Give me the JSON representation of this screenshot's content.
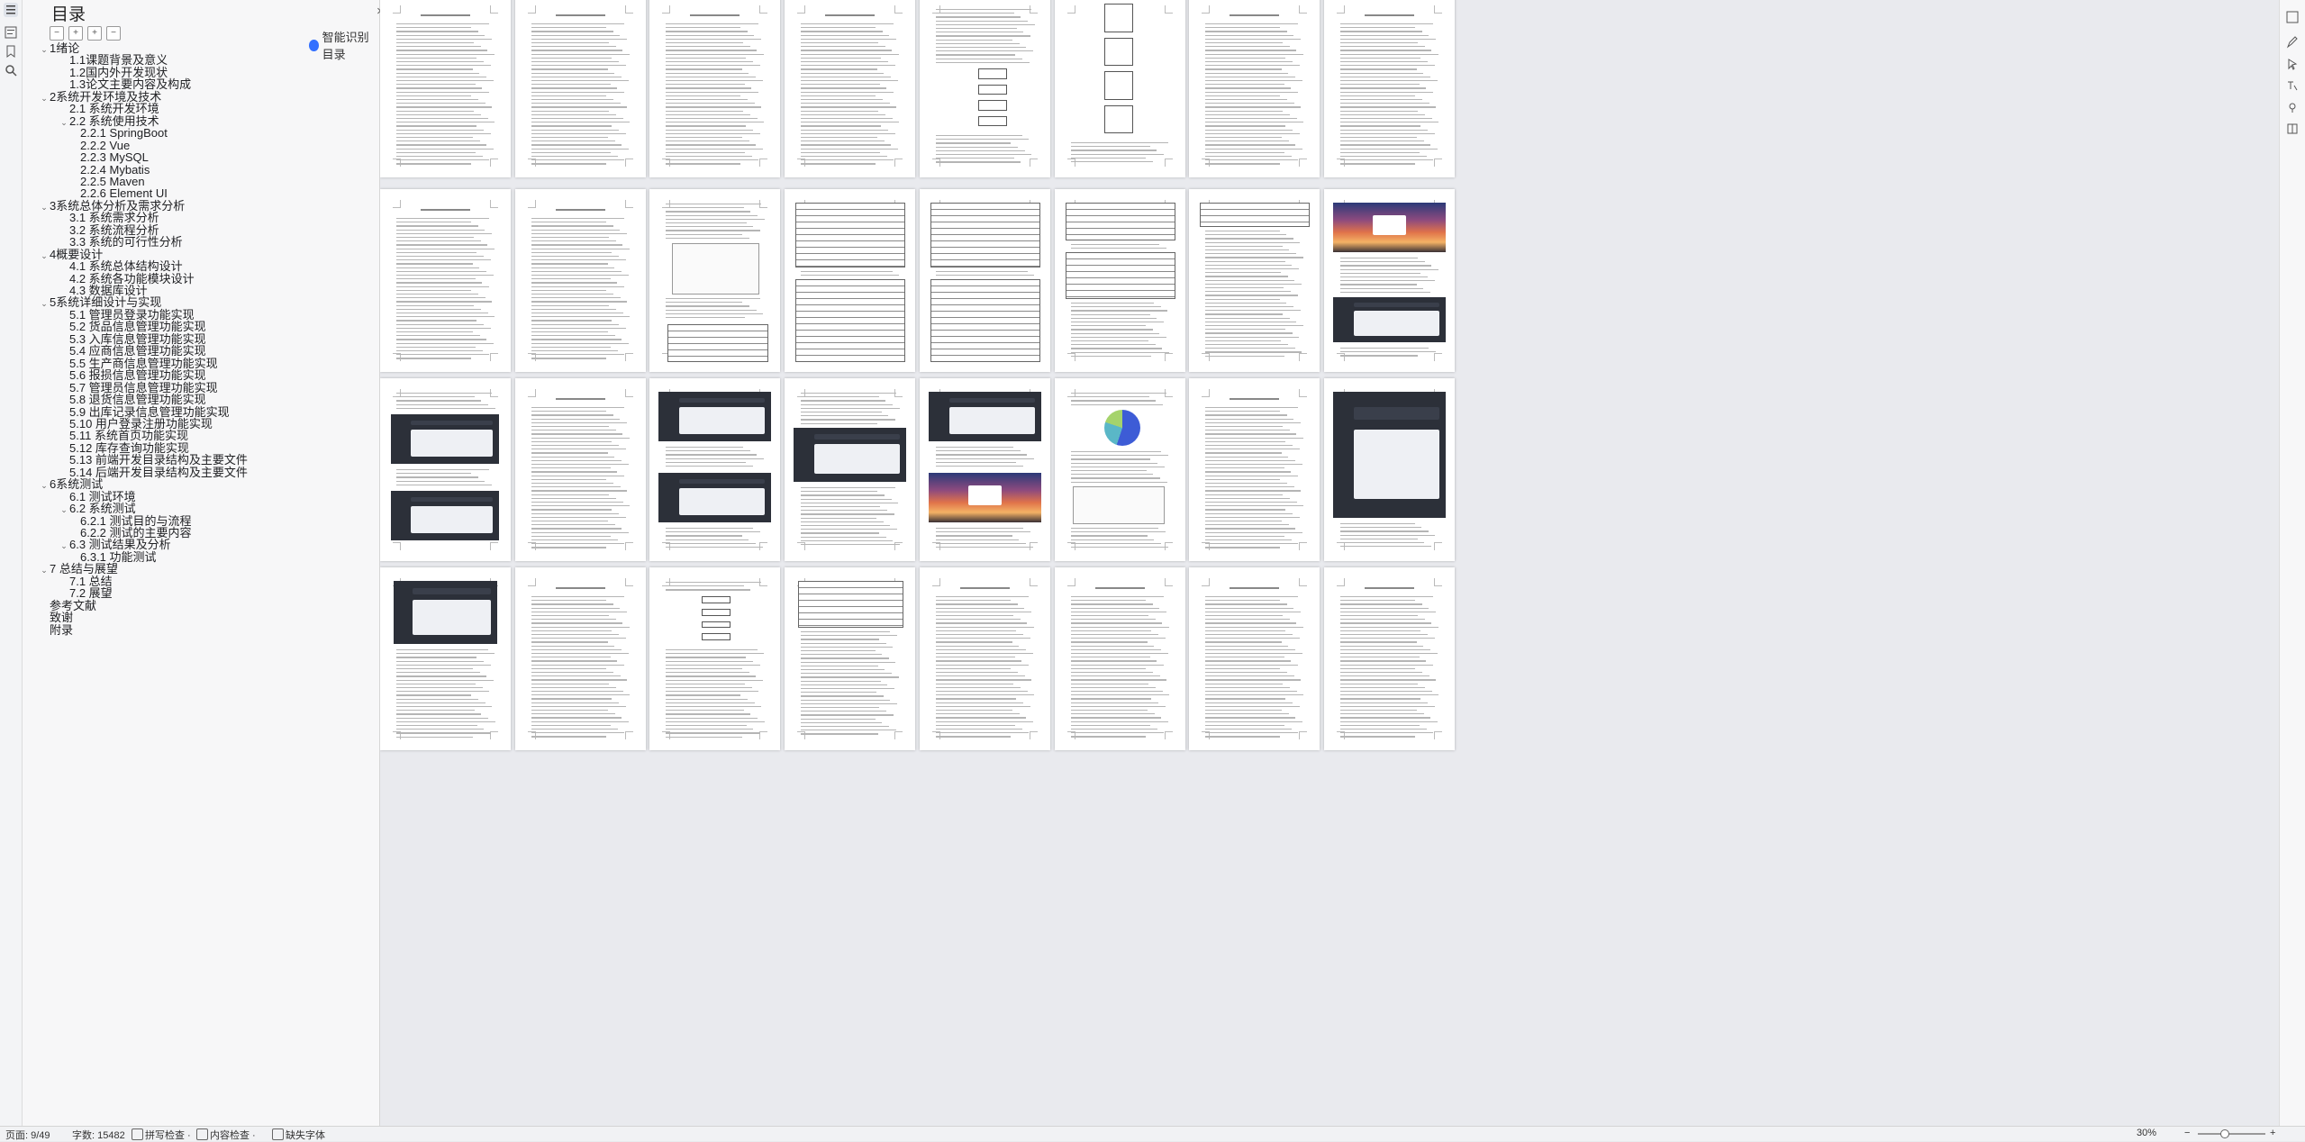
{
  "panel": {
    "title": "目录",
    "ai_label": "智能识别目录",
    "close_glyph": "×",
    "tool_glyphs": [
      "−",
      "+",
      "+",
      "−"
    ]
  },
  "toc": [
    {
      "label": "1绪论",
      "level": 0,
      "toggle": "⌄"
    },
    {
      "label": "1.1课题背景及意义",
      "level": 1,
      "toggle": ""
    },
    {
      "label": "1.2国内外开发现状",
      "level": 1,
      "toggle": ""
    },
    {
      "label": "1.3论文主要内容及构成",
      "level": 1,
      "toggle": ""
    },
    {
      "label": "2系统开发环境及技术",
      "level": 0,
      "toggle": "⌄"
    },
    {
      "label": "2.1 系统开发环境",
      "level": 1,
      "toggle": ""
    },
    {
      "label": "2.2 系统使用技术",
      "level": 1,
      "toggle": "⌄"
    },
    {
      "label": "2.2.1 SpringBoot",
      "level": 2,
      "toggle": ""
    },
    {
      "label": "2.2.2 Vue",
      "level": 2,
      "toggle": ""
    },
    {
      "label": "2.2.3 MySQL",
      "level": 2,
      "toggle": ""
    },
    {
      "label": "2.2.4 Mybatis",
      "level": 2,
      "toggle": ""
    },
    {
      "label": "2.2.5 Maven",
      "level": 2,
      "toggle": ""
    },
    {
      "label": "2.2.6 Element UI",
      "level": 2,
      "toggle": ""
    },
    {
      "label": "3系统总体分析及需求分析",
      "level": 0,
      "toggle": "⌄"
    },
    {
      "label": "3.1 系统需求分析",
      "level": 1,
      "toggle": ""
    },
    {
      "label": "3.2 系统流程分析",
      "level": 1,
      "toggle": ""
    },
    {
      "label": "3.3 系统的可行性分析",
      "level": 1,
      "toggle": ""
    },
    {
      "label": "4概要设计",
      "level": 0,
      "toggle": "⌄"
    },
    {
      "label": "4.1 系统总体结构设计",
      "level": 1,
      "toggle": ""
    },
    {
      "label": "4.2 系统各功能模块设计",
      "level": 1,
      "toggle": ""
    },
    {
      "label": "4.3 数据库设计",
      "level": 1,
      "toggle": ""
    },
    {
      "label": "5系统详细设计与实现",
      "level": 0,
      "toggle": "⌄"
    },
    {
      "label": "5.1 管理员登录功能实现",
      "level": 1,
      "toggle": ""
    },
    {
      "label": "5.2 货品信息管理功能实现",
      "level": 1,
      "toggle": ""
    },
    {
      "label": "5.3 入库信息管理功能实现",
      "level": 1,
      "toggle": ""
    },
    {
      "label": "5.4 应商信息管理功能实现",
      "level": 1,
      "toggle": ""
    },
    {
      "label": "5.5 生产商信息管理功能实现",
      "level": 1,
      "toggle": ""
    },
    {
      "label": "5.6 报损信息管理功能实现",
      "level": 1,
      "toggle": ""
    },
    {
      "label": "5.7 管理员信息管理功能实现",
      "level": 1,
      "toggle": ""
    },
    {
      "label": "5.8 退货信息管理功能实现",
      "level": 1,
      "toggle": ""
    },
    {
      "label": "5.9 出库记录信息管理功能实现",
      "level": 1,
      "toggle": ""
    },
    {
      "label": "5.10 用户登录注册功能实现",
      "level": 1,
      "toggle": ""
    },
    {
      "label": "5.11 系统首页功能实现",
      "level": 1,
      "toggle": ""
    },
    {
      "label": "5.12 库存查询功能实现",
      "level": 1,
      "toggle": ""
    },
    {
      "label": "5.13 前端开发目录结构及主要文件",
      "level": 1,
      "toggle": ""
    },
    {
      "label": "5.14 后端开发目录结构及主要文件",
      "level": 1,
      "toggle": ""
    },
    {
      "label": "6系统测试",
      "level": 0,
      "toggle": "⌄"
    },
    {
      "label": "6.1 测试环境",
      "level": 1,
      "toggle": ""
    },
    {
      "label": "6.2 系统测试",
      "level": 1,
      "toggle": "⌄"
    },
    {
      "label": "6.2.1 测试目的与流程",
      "level": 2,
      "toggle": ""
    },
    {
      "label": "6.2.2 测试的主要内容",
      "level": 2,
      "toggle": ""
    },
    {
      "label": "6.3 测试结果及分析",
      "level": 1,
      "toggle": "⌄"
    },
    {
      "label": "6.3.1 功能测试",
      "level": 2,
      "toggle": ""
    },
    {
      "label": "7 总结与展望",
      "level": 0,
      "toggle": "⌄"
    },
    {
      "label": "7.1 总结",
      "level": 1,
      "toggle": ""
    },
    {
      "label": "7.2 展望",
      "level": 1,
      "toggle": ""
    },
    {
      "label": "参考文献",
      "level": 0,
      "toggle": ""
    },
    {
      "label": "致谢",
      "level": 0,
      "toggle": ""
    },
    {
      "label": "附录",
      "level": 0,
      "toggle": ""
    }
  ],
  "status": {
    "page": "页面: 9/49",
    "words": "字数: 15482",
    "spell": "拼写检查 ·",
    "content_check": "内容检查 ·",
    "missing_font": "缺失字体",
    "zoom": "30%",
    "zoom_minus": "−",
    "zoom_plus": "+"
  },
  "colors": {
    "accent": "#3370ff",
    "panel_bg": "#f7f7f8",
    "canvas_bg": "#e9eaee"
  },
  "icons": {
    "left_rail": [
      "toc-icon",
      "outline-icon",
      "bookmark-icon",
      "search-icon"
    ],
    "right_rail": [
      "edit-icon",
      "pen-icon",
      "cursor-icon",
      "translate-icon",
      "location-icon",
      "book-icon"
    ]
  }
}
